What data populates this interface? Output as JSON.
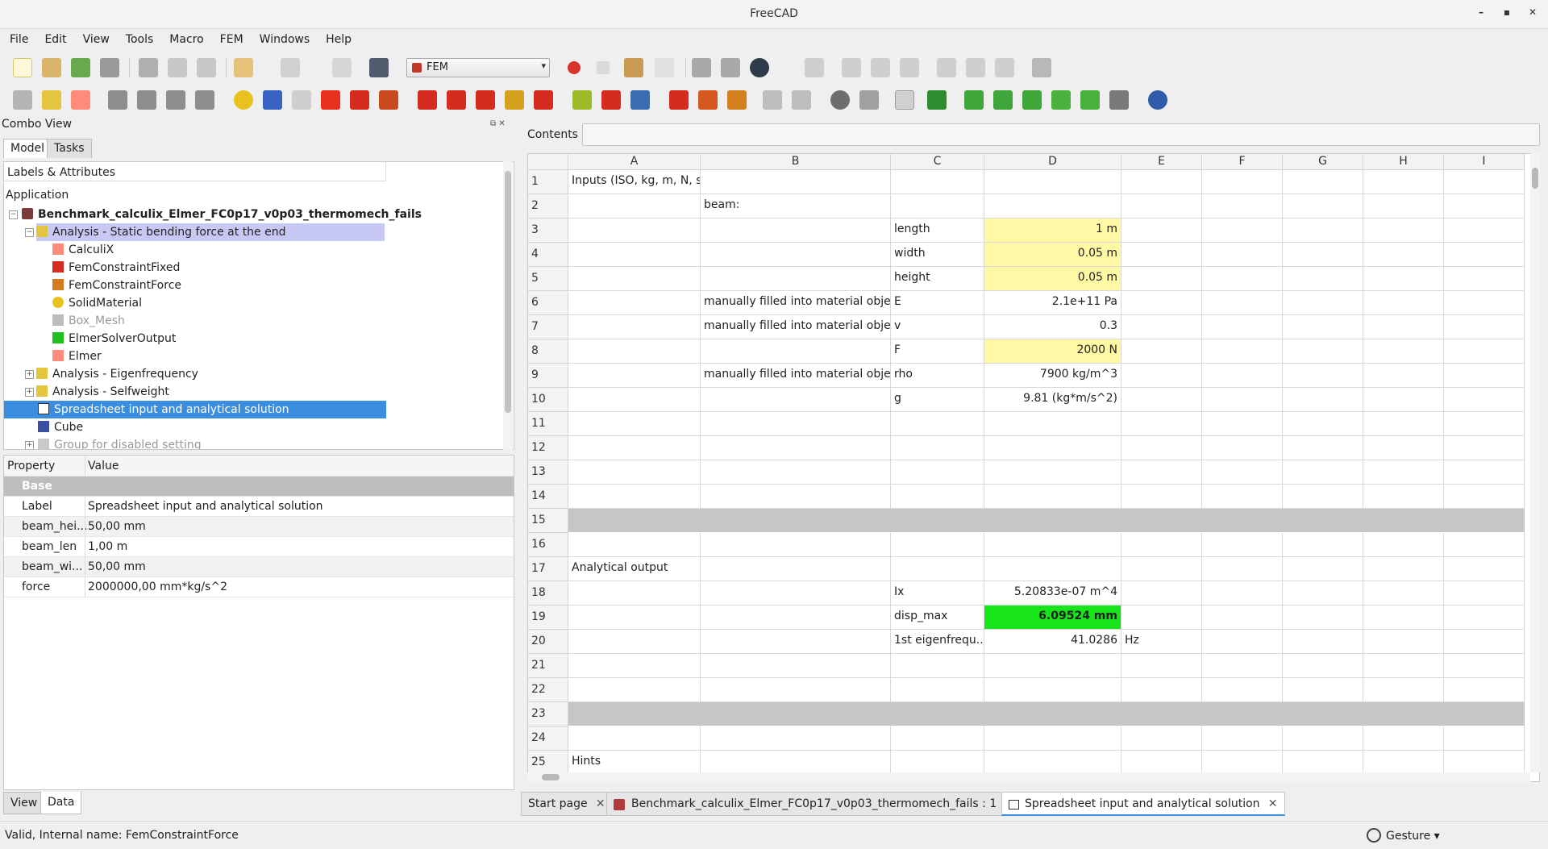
{
  "window": {
    "title": "FreeCAD"
  },
  "menu": [
    "File",
    "Edit",
    "View",
    "Tools",
    "Macro",
    "FEM",
    "Windows",
    "Help"
  ],
  "workbench": {
    "selected": "FEM"
  },
  "combo_view": {
    "title": "Combo View",
    "tabs": [
      "Model",
      "Tasks"
    ],
    "tree_header": "Labels & Attributes",
    "tree": [
      {
        "label": "Application"
      },
      {
        "label": "Benchmark_calculix_Elmer_FC0p17_v0p03_thermomech_fails"
      },
      {
        "label": "Analysis - Static bending force at the end"
      },
      {
        "label": "CalculiX"
      },
      {
        "label": "FemConstraintFixed"
      },
      {
        "label": "FemConstraintForce"
      },
      {
        "label": "SolidMaterial"
      },
      {
        "label": "Box_Mesh"
      },
      {
        "label": "ElmerSolverOutput"
      },
      {
        "label": "Elmer"
      },
      {
        "label": "Analysis - Eigenfrequency"
      },
      {
        "label": "Analysis - Selfweight"
      },
      {
        "label": "Spreadsheet input and analytical solution"
      },
      {
        "label": "Cube"
      },
      {
        "label": "Group for disabled setting"
      }
    ],
    "property_headers": {
      "property": "Property",
      "value": "Value"
    },
    "property_group": "Base",
    "properties": [
      {
        "key": "Label",
        "value": "Spreadsheet input and analytical solution"
      },
      {
        "key": "beam_hei...",
        "value": "50,00 mm"
      },
      {
        "key": "beam_len",
        "value": "1,00 m"
      },
      {
        "key": "beam_wi...",
        "value": "50,00 mm"
      },
      {
        "key": "force",
        "value": "2000000,00 mm*kg/s^2"
      }
    ],
    "bottom_tabs": [
      "View",
      "Data"
    ]
  },
  "contents": {
    "label": "Contents",
    "value": ""
  },
  "sheet": {
    "columns": [
      "A",
      "B",
      "C",
      "D",
      "E",
      "F",
      "G",
      "H",
      "I"
    ],
    "rows": [
      "1",
      "2",
      "3",
      "4",
      "5",
      "6",
      "7",
      "8",
      "9",
      "10",
      "11",
      "12",
      "13",
      "14",
      "15",
      "16",
      "17",
      "18",
      "19",
      "20",
      "21",
      "22",
      "23",
      "24",
      "25"
    ],
    "cells": {
      "A1": "Inputs (ISO, kg, m, N, s)",
      "B2": "beam:",
      "C3": "length",
      "D3": "1 m",
      "C4": "width",
      "D4": "0.05 m",
      "C5": "height",
      "D5": "0.05 m",
      "B6": "manually filled into material object",
      "C6": "E",
      "D6": "2.1e+11 Pa",
      "B7": "manually filled into material object",
      "C7": "v",
      "D7": "0.3",
      "C8": "F",
      "D8": "2000 N",
      "B9": "manually filled into material object",
      "C9": "rho",
      "D9": "7900 kg/m^3",
      "C10": "g",
      "D10": "9.81 (kg*m/s^2)",
      "A17": "Analytical output",
      "C18": "Ix",
      "D18": "5.20833e-07 m^4",
      "C19": "disp_max",
      "D19": "6.09524 mm",
      "C20": "1st eigenfrequ...",
      "D20": "41.0286",
      "E20": "Hz",
      "A25": "Hints"
    }
  },
  "doc_tabs": [
    {
      "label": "Start page"
    },
    {
      "label": "Benchmark_calculix_Elmer_FC0p17_v0p03_thermomech_fails : 1"
    },
    {
      "label": "Spreadsheet input and analytical solution"
    }
  ],
  "status": {
    "text": "Valid, Internal name: FemConstraintForce",
    "nav_style": "Gesture"
  },
  "colors": {
    "selection": "#3b8de0",
    "yellow_cell": "#fff9a6",
    "green_cell": "#17e51a",
    "gray_row": "#c6c6c6"
  }
}
